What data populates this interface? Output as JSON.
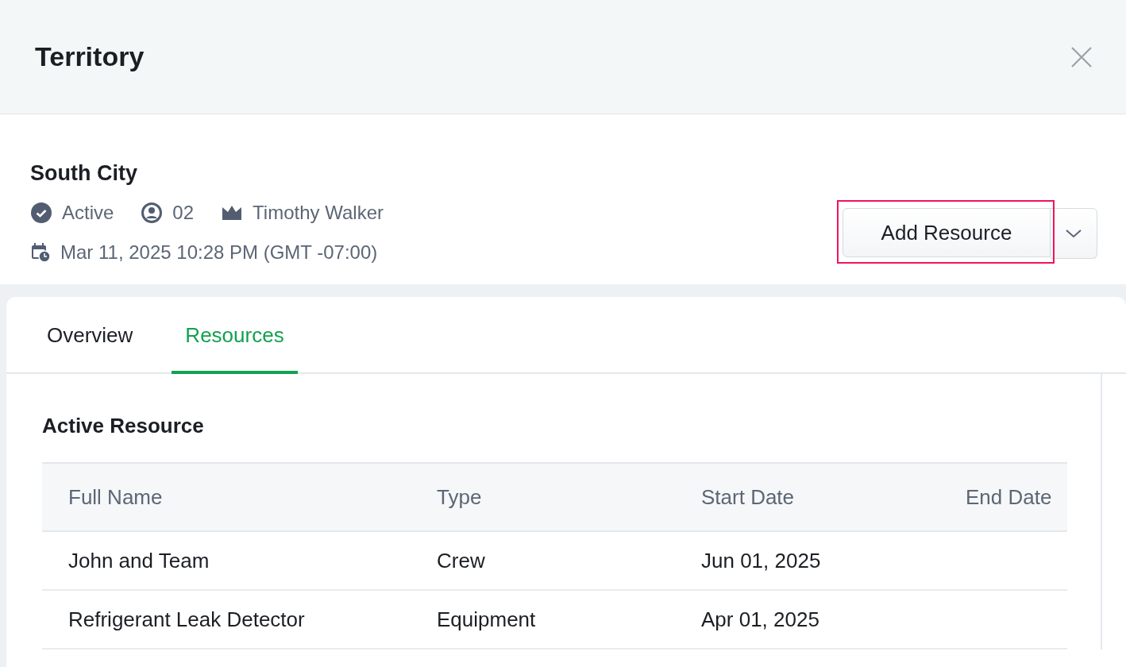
{
  "window": {
    "title": "Territory"
  },
  "territory": {
    "name": "South City",
    "status": "Active",
    "count": "02",
    "owner": "Timothy Walker",
    "created": "Mar 11, 2025 10:28 PM (GMT -07:00)"
  },
  "primary_button": {
    "label": "Add Resource",
    "highlighted": true
  },
  "tabs": [
    {
      "label": "Overview",
      "selected": false
    },
    {
      "label": "Resources",
      "selected": true
    }
  ],
  "section": {
    "title": "Active Resource"
  },
  "table": {
    "columns": [
      "Full Name",
      "Type",
      "Start Date",
      "End Date"
    ],
    "rows": [
      [
        "John and Team",
        "Crew",
        "Jun 01, 2025",
        ""
      ],
      [
        "Refrigerant Leak Detector",
        "Equipment",
        "Apr 01, 2025",
        ""
      ]
    ]
  }
}
